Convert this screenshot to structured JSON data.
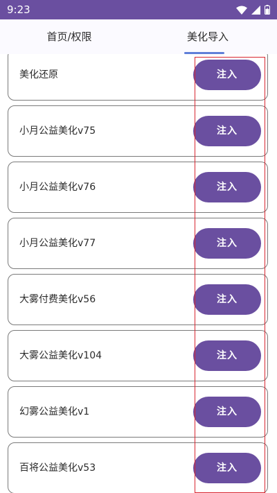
{
  "status_bar": {
    "time": "9:23",
    "icons": [
      "wifi-icon",
      "signal-icon",
      "battery-icon"
    ]
  },
  "tabs": [
    {
      "label": "首页/权限",
      "selected": false
    },
    {
      "label": "美化导入",
      "selected": true
    }
  ],
  "items": [
    {
      "label": "美化还原",
      "button": "注入"
    },
    {
      "label": "小月公益美化v75",
      "button": "注入"
    },
    {
      "label": "小月公益美化v76",
      "button": "注入"
    },
    {
      "label": "小月公益美化v77",
      "button": "注入"
    },
    {
      "label": "大雾付费美化v56",
      "button": "注入"
    },
    {
      "label": "大雾公益美化v104",
      "button": "注入"
    },
    {
      "label": "幻雾公益美化v1",
      "button": "注入"
    },
    {
      "label": "百将公益美化v53",
      "button": "注入"
    }
  ],
  "colors": {
    "primary": "#6a4fa0",
    "tab_indicator": "#5f7fd8",
    "highlight": "#d8252f"
  }
}
